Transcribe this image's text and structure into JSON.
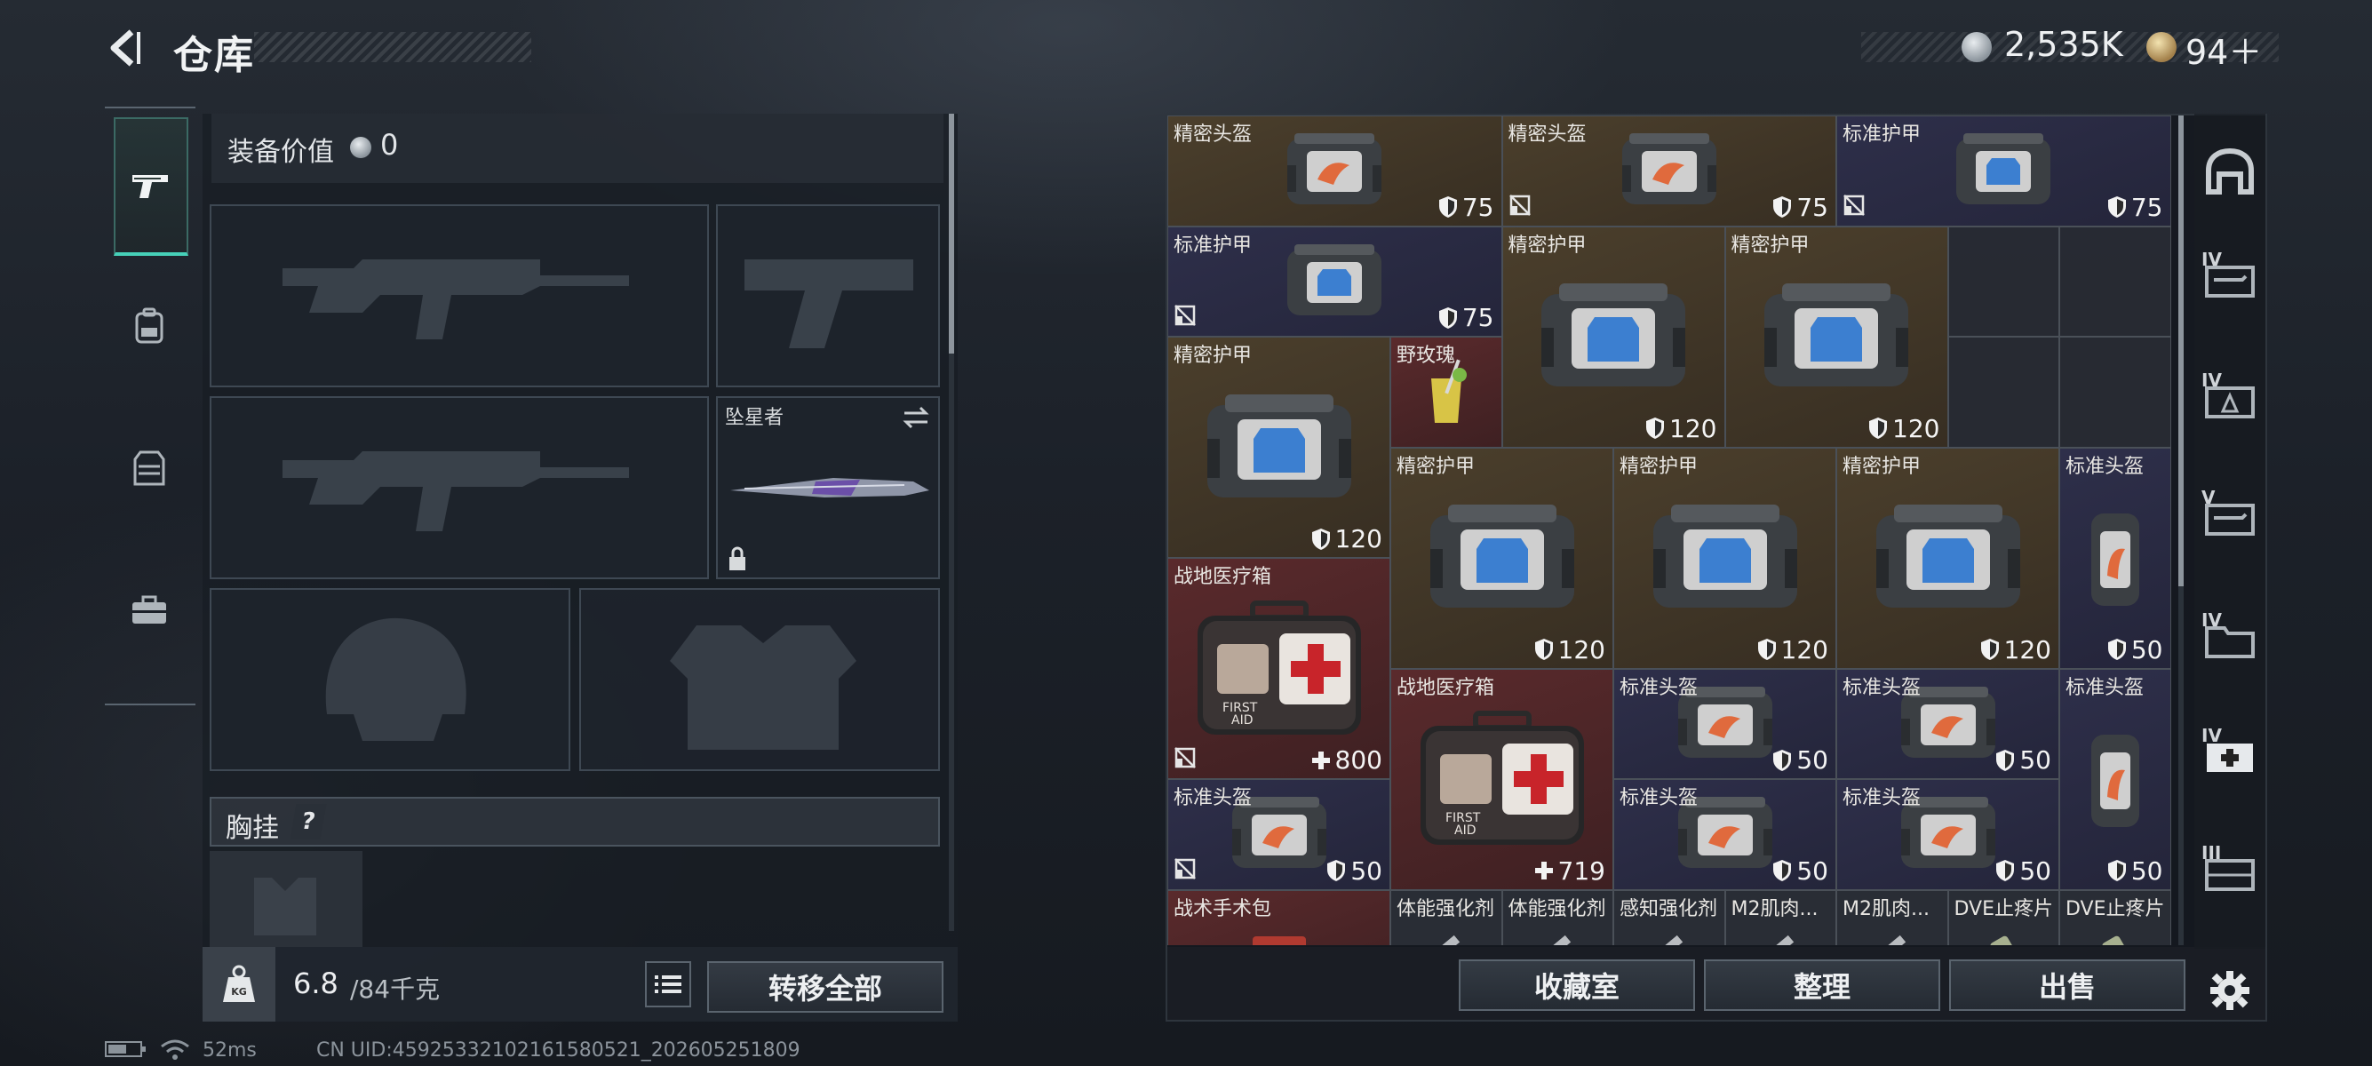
{
  "header": {
    "title": "仓库",
    "silver_amount": "2,535K",
    "gold_amount": "94＋"
  },
  "left_tabs": [
    {
      "name": "weapons",
      "icon": "pistol-icon",
      "active": true
    },
    {
      "name": "backpack",
      "icon": "backpack-icon",
      "active": false
    },
    {
      "name": "vest",
      "icon": "vest-icon",
      "active": false
    },
    {
      "name": "case",
      "icon": "briefcase-icon",
      "active": false
    }
  ],
  "equipment": {
    "value_label": "装备价值",
    "value": "0",
    "melee_name": "坠星者",
    "chest_rig_label": "胸挂",
    "help_mark": "?"
  },
  "capacity": {
    "current": "6.8",
    "max": "/84千克"
  },
  "buttons": {
    "transfer_all": "转移全部",
    "collection": "收藏室",
    "sort": "整理",
    "sell": "出售"
  },
  "items": [
    {
      "name": "精密头盔",
      "value": "75",
      "kind": "shield"
    },
    {
      "name": "精密头盔",
      "value": "75",
      "kind": "shield"
    },
    {
      "name": "标准护甲",
      "value": "75",
      "kind": "shield"
    },
    {
      "name": "标准护甲",
      "value": "75",
      "kind": "shield"
    },
    {
      "name": "精密护甲",
      "value": "120",
      "kind": "shield"
    },
    {
      "name": "精密护甲",
      "value": "120",
      "kind": "shield"
    },
    {
      "name": "精密护甲",
      "value": "120",
      "kind": "shield"
    },
    {
      "name": "野玫瑰",
      "value": "",
      "kind": "none"
    },
    {
      "name": "精密护甲",
      "value": "120",
      "kind": "shield"
    },
    {
      "name": "精密护甲",
      "value": "120",
      "kind": "shield"
    },
    {
      "name": "精密护甲",
      "value": "120",
      "kind": "shield"
    },
    {
      "name": "标准头盔",
      "value": "50",
      "kind": "shield"
    },
    {
      "name": "战地医疗箱",
      "value": "800",
      "kind": "plus"
    },
    {
      "name": "战地医疗箱",
      "value": "719",
      "kind": "plus"
    },
    {
      "name": "标准头盔",
      "value": "50",
      "kind": "shield"
    },
    {
      "name": "标准头盔",
      "value": "50",
      "kind": "shield"
    },
    {
      "name": "标准头盔",
      "value": "50",
      "kind": "shield"
    },
    {
      "name": "标准头盔",
      "value": "50",
      "kind": "shield"
    },
    {
      "name": "标准头盔",
      "value": "50",
      "kind": "shield"
    },
    {
      "name": "标准头盔",
      "value": "50",
      "kind": "shield"
    },
    {
      "name": "战术手术包",
      "value": "",
      "kind": "none"
    },
    {
      "name": "体能强化剂",
      "value": "",
      "kind": "none"
    },
    {
      "name": "体能强化剂",
      "value": "",
      "kind": "none"
    },
    {
      "name": "感知强化剂",
      "value": "",
      "kind": "none"
    },
    {
      "name": "M2肌肉...",
      "value": "",
      "kind": "none"
    },
    {
      "name": "M2肌肉...",
      "value": "",
      "kind": "none"
    },
    {
      "name": "DVE止疼片",
      "value": "",
      "kind": "none"
    },
    {
      "name": "DVE止疼片",
      "value": "",
      "kind": "none"
    }
  ],
  "right_tabs": [
    {
      "icon": "helmet-icon",
      "tier": ""
    },
    {
      "icon": "weapon-case-icon",
      "tier": "IV"
    },
    {
      "icon": "ammo-case-icon",
      "tier": "IV"
    },
    {
      "icon": "weapon-case-icon",
      "tier": "V"
    },
    {
      "icon": "folder-case-icon",
      "tier": "IV"
    },
    {
      "icon": "medical-case-icon",
      "tier": "IV"
    },
    {
      "icon": "crate-icon",
      "tier": "III"
    }
  ],
  "status": {
    "ping": "52ms",
    "uid": "CN UID:459253321021615805​21_202605251809"
  },
  "colors": {
    "accent": "#46d1b9",
    "gold_rarity": "#4b3f2c",
    "purple_rarity": "#2e2f4a",
    "red_rarity": "#5a2a2c"
  }
}
